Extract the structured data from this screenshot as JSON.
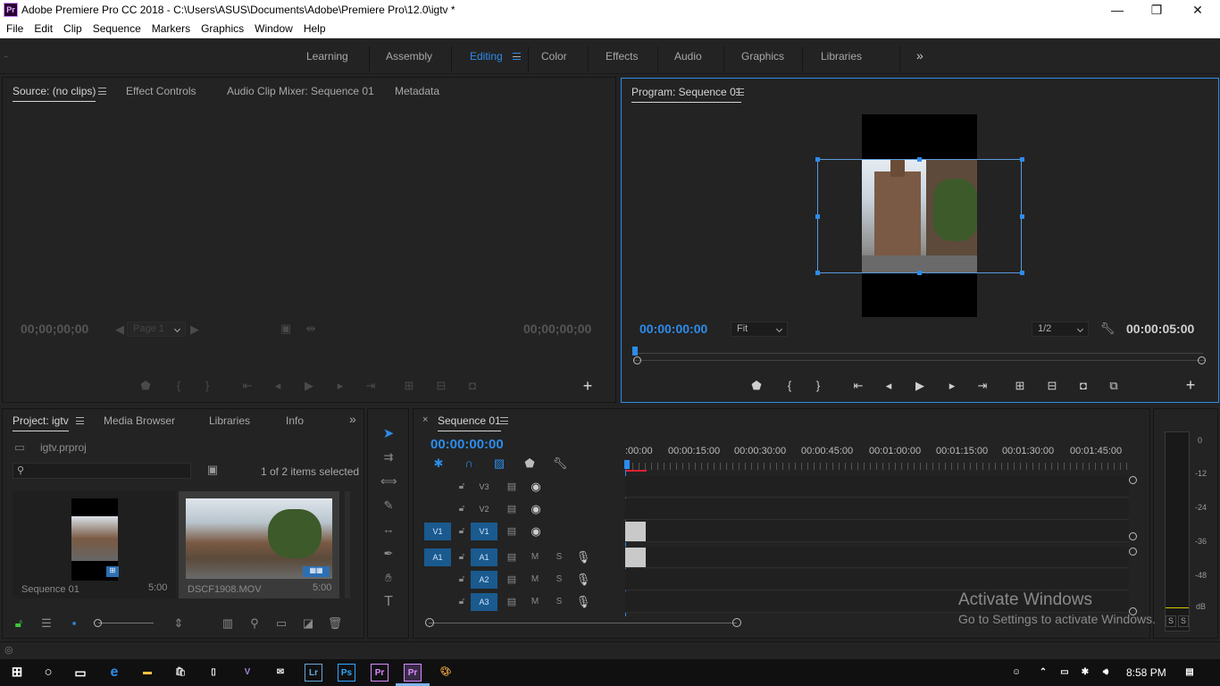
{
  "window": {
    "title": "Adobe Premiere Pro CC 2018 - C:\\Users\\ASUS\\Documents\\Adobe\\Premiere Pro\\12.0\\igtv *",
    "app_icon": "Pr",
    "controls": {
      "minimize": "—",
      "maximize": "❐",
      "close": "✕"
    }
  },
  "menubar": [
    "File",
    "Edit",
    "Clip",
    "Sequence",
    "Markers",
    "Graphics",
    "Window",
    "Help"
  ],
  "workspaces": {
    "tabs": [
      "Learning",
      "Assembly",
      "Editing",
      "Color",
      "Effects",
      "Audio",
      "Graphics",
      "Libraries"
    ],
    "active": "Editing",
    "more": "»"
  },
  "source_panel": {
    "tabs": [
      "Source: (no clips)",
      "Effect Controls",
      "Audio Clip Mixer: Sequence 01",
      "Metadata"
    ],
    "timecode_left": "00;00;00;00",
    "timecode_right": "00;00;00;00",
    "page_label": "Page 1"
  },
  "program_panel": {
    "title": "Program: Sequence 01",
    "timecode": "00:00:00:00",
    "duration": "00:00:05:00",
    "zoom": "Fit",
    "resolution": "1/2"
  },
  "project_panel": {
    "tabs": [
      "Project: igtv",
      "Media Browser",
      "Libraries",
      "Info"
    ],
    "file": "igtv.prproj",
    "status": "1 of 2 items selected",
    "items": [
      {
        "name": "Sequence 01",
        "duration": "5:00"
      },
      {
        "name": "DSCF1908.MOV",
        "duration": "5:00"
      }
    ]
  },
  "timeline": {
    "tab": "Sequence 01",
    "timecode": "00:00:00:00",
    "ruler": [
      ":00:00",
      "00:00:15:00",
      "00:00:30:00",
      "00:00:45:00",
      "00:01:00:00",
      "00:01:15:00",
      "00:01:30:00",
      "00:01:45:00"
    ],
    "video_tracks": [
      {
        "name": "V3",
        "src": ""
      },
      {
        "name": "V2",
        "src": ""
      },
      {
        "name": "V1",
        "src": "V1"
      }
    ],
    "audio_tracks": [
      {
        "name": "A1",
        "src": "A1"
      },
      {
        "name": "A2",
        "src": ""
      },
      {
        "name": "A3",
        "src": ""
      }
    ],
    "mute": "M",
    "solo": "S"
  },
  "meter": {
    "scale": [
      "0",
      "-12",
      "-24",
      "-36",
      "-48",
      "dB"
    ],
    "solo": "S",
    "solo2": "S"
  },
  "watermark": {
    "line1": "Activate Windows",
    "line2": "Go to Settings to activate Windows."
  },
  "taskbar": {
    "time": "8:58 PM",
    "apps": [
      "e",
      "Lr",
      "Ps",
      "Pr",
      "Pr"
    ]
  }
}
